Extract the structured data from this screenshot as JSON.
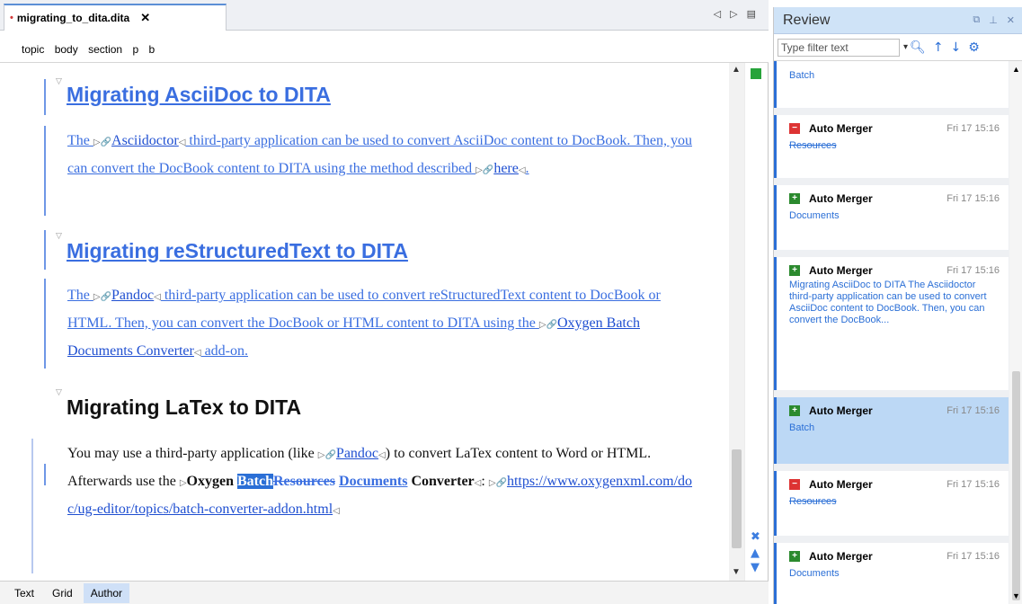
{
  "editor": {
    "tab": {
      "modified_marker": "•",
      "title": "migrating_to_dita.dita",
      "close": "✕"
    },
    "tab_nav": [
      "◁",
      "▷",
      "▤"
    ],
    "breadcrumb": [
      "topic",
      "body",
      "section",
      "p",
      "b"
    ],
    "sections": [
      {
        "title": "Migrating AsciiDoc to DITA",
        "para": {
          "pre": "The ",
          "link": "Asciidoctor",
          "mid": " third-party application can be used to convert AsciiDoc content to DocBook. Then, you can convert the DocBook content to DITA using the method described ",
          "link2": "here",
          "post": "."
        }
      },
      {
        "title": "Migrating reStructuredText to DITA",
        "para": {
          "pre": "The ",
          "link": "Pandoc",
          "mid": " third-party application can be used to convert reStructuredText content to DocBook or HTML. Then, you can convert the DocBook or HTML content to DITA using the ",
          "link2": "Oxygen Batch Documents Converter",
          "post": " add-on."
        }
      },
      {
        "title": "Migrating LaTex to DITA",
        "para": {
          "pre": "You may use a third-party application (like ",
          "link": "Pandoc",
          "mid": ") to convert LaTex content to Word or HTML. Afterwards use the ",
          "bold1": "Oxygen ",
          "selected": "Batch",
          "deleted": "Resources",
          "inserted": "Documents",
          "bold2": "Converter",
          "sep": ": ",
          "url": "https://www.oxygenxml.com/doc/ug-editor/topics/batch-converter-addon.html"
        }
      }
    ],
    "modes": [
      "Text",
      "Grid",
      "Author"
    ],
    "active_mode": "Author"
  },
  "review": {
    "title": "Review",
    "header_controls": [
      "⧉",
      "⊥",
      "✕"
    ],
    "filter_placeholder": "Type filter text",
    "partial_top_text": "Batch",
    "cards": [
      {
        "kind": "remove",
        "author": "Auto Merger",
        "time": "Fri 17 15:16",
        "text": "Resources",
        "selected": false
      },
      {
        "kind": "add",
        "author": "Auto Merger",
        "time": "Fri 17 15:16",
        "text": "Documents",
        "selected": false
      },
      {
        "kind": "add",
        "author": "Auto Merger",
        "time": "Fri 17 15:16",
        "text": "Migrating AsciiDoc to DITA The Asciidoctor third-party application can be used to convert AsciiDoc content to DocBook. Then, you can convert the DocBook...",
        "selected": false
      },
      {
        "kind": "add",
        "author": "Auto Merger",
        "time": "Fri 17 15:16",
        "text": "Batch",
        "selected": true
      },
      {
        "kind": "remove",
        "author": "Auto Merger",
        "time": "Fri 17 15:16",
        "text": "Resources",
        "selected": false
      },
      {
        "kind": "add",
        "author": "Auto Merger",
        "time": "Fri 17 15:16",
        "text": "Documents",
        "selected": false
      }
    ]
  },
  "colors": {
    "accent": "#2b6fd6",
    "insert": "#3a6ee0",
    "remove_icon": "#dd3333",
    "add_icon": "#2b8a2e",
    "selected_card": "#bcd8f5"
  }
}
